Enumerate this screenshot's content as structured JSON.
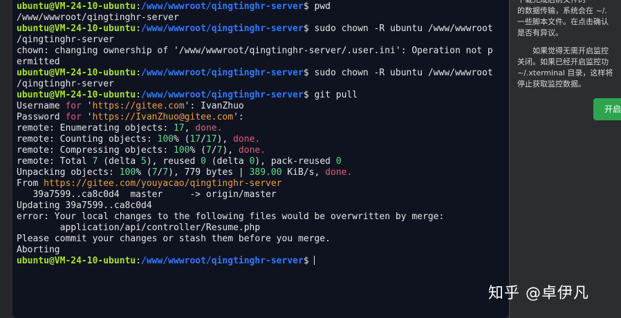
{
  "terminal": {
    "user": "ubuntu@VM-24-10-ubuntu",
    "path": "/www/wwwroot/qingtinghr-server",
    "lines": [
      {
        "type": "prompt",
        "cmd": "pwd"
      },
      {
        "type": "out",
        "text": "/www/wwwroot/qingtinghr-server"
      },
      {
        "type": "prompt",
        "cmd": "sudo chown -R ubuntu /www/wwwroot"
      },
      {
        "type": "out",
        "text": "/qingtinghr-server"
      },
      {
        "type": "out",
        "text": "chown: changing ownership of '/www/wwwroot/qingtinghr-server/.user.ini': Operation not p"
      },
      {
        "type": "out",
        "text": "ermitted"
      },
      {
        "type": "prompt",
        "cmd": "sudo chown -R ubuntu /www/wwwroot"
      },
      {
        "type": "out",
        "text": "/qingtinghr-server"
      },
      {
        "type": "prompt",
        "cmd": "git pull"
      },
      {
        "type": "out",
        "segments": [
          {
            "t": "Username "
          },
          {
            "t": "for",
            "c": "kw"
          },
          {
            "t": " '"
          },
          {
            "t": "https://gitee.com",
            "c": "str"
          },
          {
            "t": "': IvanZhuo"
          }
        ]
      },
      {
        "type": "out",
        "segments": [
          {
            "t": "Password "
          },
          {
            "t": "for",
            "c": "kw"
          },
          {
            "t": " '"
          },
          {
            "t": "https://IvanZhuo@gitee.com",
            "c": "str"
          },
          {
            "t": "':"
          }
        ]
      },
      {
        "type": "out",
        "segments": [
          {
            "t": "remote: Enumerating objects: "
          },
          {
            "t": "17",
            "c": "num"
          },
          {
            "t": ", "
          },
          {
            "t": "done.",
            "c": "kw"
          }
        ]
      },
      {
        "type": "out",
        "segments": [
          {
            "t": "remote: Counting objects: "
          },
          {
            "t": "100",
            "c": "num"
          },
          {
            "t": "% ("
          },
          {
            "t": "17",
            "c": "num"
          },
          {
            "t": "/"
          },
          {
            "t": "17",
            "c": "num"
          },
          {
            "t": "), "
          },
          {
            "t": "done.",
            "c": "kw"
          }
        ]
      },
      {
        "type": "out",
        "segments": [
          {
            "t": "remote: Compressing objects: "
          },
          {
            "t": "100",
            "c": "num"
          },
          {
            "t": "% ("
          },
          {
            "t": "7",
            "c": "num"
          },
          {
            "t": "/"
          },
          {
            "t": "7",
            "c": "num"
          },
          {
            "t": "), "
          },
          {
            "t": "done.",
            "c": "kw"
          }
        ]
      },
      {
        "type": "out",
        "segments": [
          {
            "t": "remote: Total "
          },
          {
            "t": "7",
            "c": "num"
          },
          {
            "t": " (delta "
          },
          {
            "t": "5",
            "c": "num"
          },
          {
            "t": "), reused "
          },
          {
            "t": "0",
            "c": "num"
          },
          {
            "t": " (delta "
          },
          {
            "t": "0",
            "c": "num"
          },
          {
            "t": "), pack-reused "
          },
          {
            "t": "0",
            "c": "num"
          }
        ]
      },
      {
        "type": "out",
        "segments": [
          {
            "t": "Unpacking objects: "
          },
          {
            "t": "100",
            "c": "num"
          },
          {
            "t": "% ("
          },
          {
            "t": "7",
            "c": "num"
          },
          {
            "t": "/"
          },
          {
            "t": "7",
            "c": "num"
          },
          {
            "t": "), 779 bytes | "
          },
          {
            "t": "389.00",
            "c": "num"
          },
          {
            "t": " KiB/s, "
          },
          {
            "t": "done.",
            "c": "kw"
          }
        ]
      },
      {
        "type": "out",
        "segments": [
          {
            "t": "From "
          },
          {
            "t": "https://gitee.com/youyacao/qingtinghr-server",
            "c": "str"
          }
        ]
      },
      {
        "type": "out",
        "text": "   39a7599..ca8c0d4  master     -> origin/master"
      },
      {
        "type": "out",
        "text": "Updating 39a7599..ca8c0d4"
      },
      {
        "type": "out",
        "text": "error: Your local changes to the following files would be overwritten by merge:"
      },
      {
        "type": "out",
        "text": "        application/api/controller/Resume.php"
      },
      {
        "type": "out",
        "text": "Please commit your changes or stash them before you merge."
      },
      {
        "type": "out",
        "text": "Aborting"
      },
      {
        "type": "prompt",
        "cmd": "",
        "cursor": true
      }
    ]
  },
  "side_panel": {
    "lines": [
      "下载完成后前文件的",
      "的数据传输，系统会在 ~/.",
      "一些脚本文件。在点击确认",
      "是否有异议。",
      "如果觉得无需开启监控",
      "关闭。如果已经开启监控功",
      "~/.xterminal 目录，这样将",
      "停止获取监控数据。"
    ],
    "button_label": "开启"
  },
  "watermark": "知乎 @卓伊凡"
}
